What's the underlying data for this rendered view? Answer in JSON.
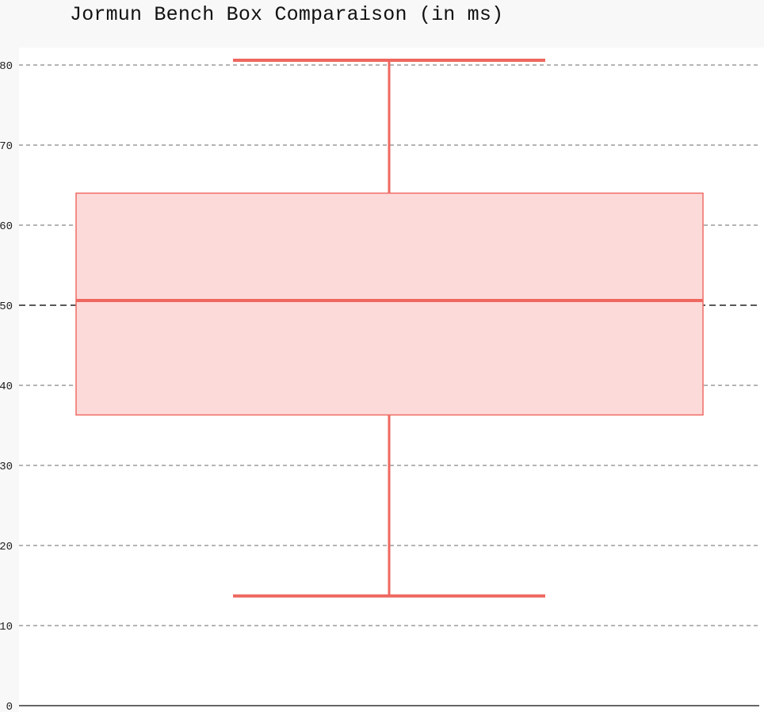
{
  "chart_data": {
    "type": "box",
    "title": "Jormun Bench Box Comparaison (in ms)",
    "xlabel": "",
    "ylabel": "",
    "ylim": [
      0,
      81
    ],
    "y_ticks": [
      0,
      10,
      20,
      30,
      40,
      50,
      60,
      70,
      80
    ],
    "y_tick_labels": [
      "0",
      "10",
      "20",
      "30",
      "40",
      "50",
      "60",
      "70",
      "80"
    ],
    "grid": true,
    "reference_line": 50,
    "series": [
      {
        "min": 13.7,
        "q1": 36.3,
        "median": 50.6,
        "q3": 64.0,
        "max": 80.6
      }
    ],
    "colors": {
      "box_fill": "#fcdad9",
      "box_stroke": "#ef6c64",
      "whisker": "#ee6860",
      "grid": "#888888",
      "reference_line": "#222222",
      "axis": "#333333"
    }
  }
}
